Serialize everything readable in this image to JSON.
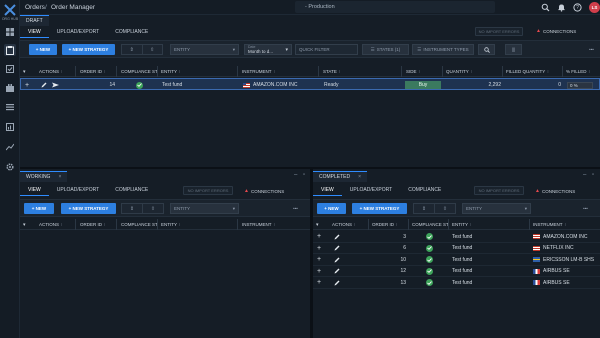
{
  "app": {
    "logo_text": "ORG HUB"
  },
  "breadcrumb": {
    "root": "Orders",
    "sep": "/",
    "page": "Order Manager"
  },
  "environment": "- Production",
  "user": {
    "initials": "LS"
  },
  "colors": {
    "accent": "#2f8cff",
    "primary_button": "#2d7fe0",
    "buy": "#3b7a5f",
    "ok": "#3da35a",
    "warn": "#e5484d"
  },
  "toolbar_common": {
    "view": "VIEW",
    "upload": "UPLOAD/EXPORT",
    "compliance": "COMPLIANCE",
    "no_import": "NO IMPORT ERRORS",
    "connections": "CONNECTIONS",
    "new": "+ NEW",
    "new_strategy": "+ NEW STRATEGY",
    "entity": "ENTITY"
  },
  "draft": {
    "tab": "DRAFT",
    "grouping": {
      "label": "Date",
      "value": "Month to d..."
    },
    "quick_filter": "QUICK FILTER",
    "states_btn": "STATES (1)",
    "instr_types_btn": "INSTRUMENT TYPES",
    "columns": [
      "ACTIONS",
      "ORDER ID",
      "COMPLIANCE ST.",
      "ENTITY",
      "INSTRUMENT",
      "STATE",
      "SIDE",
      "QUANTITY",
      "FILLED QUANTITY",
      "% FILLED"
    ],
    "rows": [
      {
        "order_id": "14",
        "entity": "Test fund",
        "instrument": "AMAZON.COM INC",
        "state": "Ready",
        "side": "Buy",
        "quantity": "2,292",
        "filled": "0",
        "pct": "0 %"
      }
    ]
  },
  "working": {
    "tab": "WORKING",
    "close": "×",
    "columns": [
      "ACTIONS",
      "ORDER ID",
      "COMPLIANCE ST.",
      "ENTITY",
      "INSTRUMENT"
    ]
  },
  "completed": {
    "tab": "COMPLETED",
    "close": "×",
    "columns": [
      "ACTIONS",
      "ORDER ID",
      "COMPLIANCE ST.",
      "ENTITY",
      "INSTRUMENT"
    ],
    "rows": [
      {
        "order_id": "3",
        "entity": "Test fund",
        "instrument": "AMAZON.COM INC",
        "flag": "us"
      },
      {
        "order_id": "6",
        "entity": "Test fund",
        "instrument": "NETFLIX INC",
        "flag": "us"
      },
      {
        "order_id": "10",
        "entity": "Test fund",
        "instrument": "ERICSSON LM-B SHS",
        "flag": "se"
      },
      {
        "order_id": "12",
        "entity": "Test fund",
        "instrument": "AIRBUS SE",
        "flag": "fr"
      },
      {
        "order_id": "13",
        "entity": "Test fund",
        "instrument": "AIRBUS SE",
        "flag": "fr"
      }
    ]
  }
}
